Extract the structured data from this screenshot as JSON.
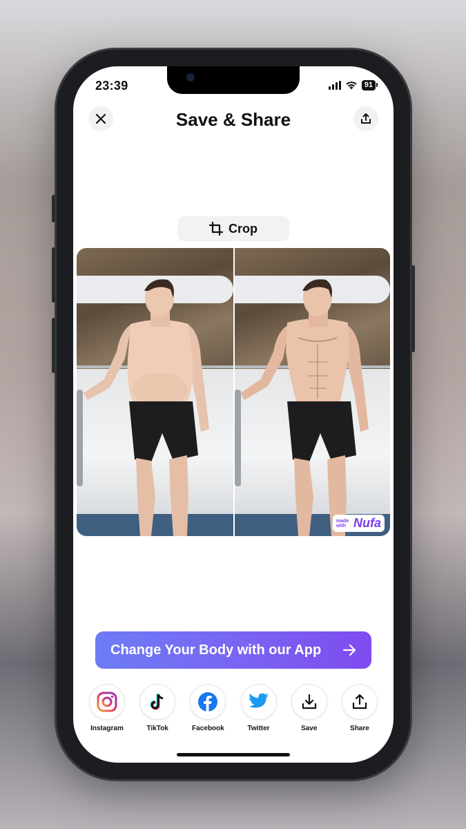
{
  "status_bar": {
    "time": "23:39",
    "battery": "91"
  },
  "header": {
    "title": "Save & Share",
    "close_icon": "close-icon",
    "export_icon": "upload-icon"
  },
  "crop": {
    "label": "Crop",
    "icon": "crop-icon"
  },
  "comparison": {
    "before_image": "before-photo",
    "after_image": "after-photo",
    "badge_small": "made with",
    "badge_brand": "Nufa"
  },
  "cta": {
    "label": "Change Your Body with our App",
    "icon": "arrow-right-icon"
  },
  "share": [
    {
      "label": "Instagram",
      "icon": "instagram-icon"
    },
    {
      "label": "TikTok",
      "icon": "tiktok-icon"
    },
    {
      "label": "Facebook",
      "icon": "facebook-icon"
    },
    {
      "label": "Twitter",
      "icon": "twitter-icon"
    },
    {
      "label": "Save",
      "icon": "download-icon"
    },
    {
      "label": "Share",
      "icon": "share-icon"
    }
  ],
  "colors": {
    "accent_start": "#6d7cf5",
    "accent_end": "#7f4bef",
    "brand": "#7a3cf0"
  }
}
